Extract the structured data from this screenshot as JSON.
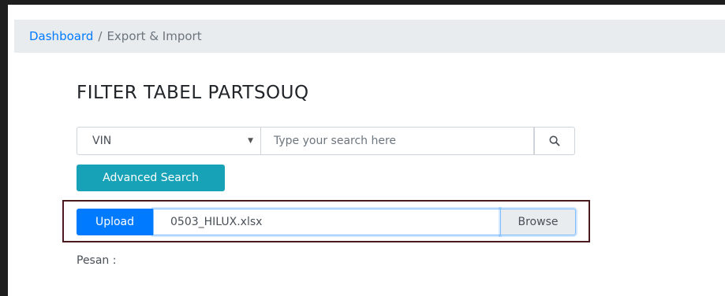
{
  "breadcrumb": {
    "home": "Dashboard",
    "separator": "/",
    "current": "Export & Import"
  },
  "page": {
    "title": "FILTER TABEL PARTSOUQ"
  },
  "search": {
    "select_value": "VIN",
    "placeholder": "Type your search here",
    "search_icon": "search-icon"
  },
  "advanced": {
    "label": "Advanced Search"
  },
  "upload": {
    "button_label": "Upload",
    "file_name": "0503_HILUX.xlsx",
    "browse_label": "Browse"
  },
  "message": {
    "label": "Pesan :"
  },
  "colors": {
    "primary": "#007bff",
    "info": "#17a2b8",
    "highlight_frame": "#4a1a1f"
  }
}
